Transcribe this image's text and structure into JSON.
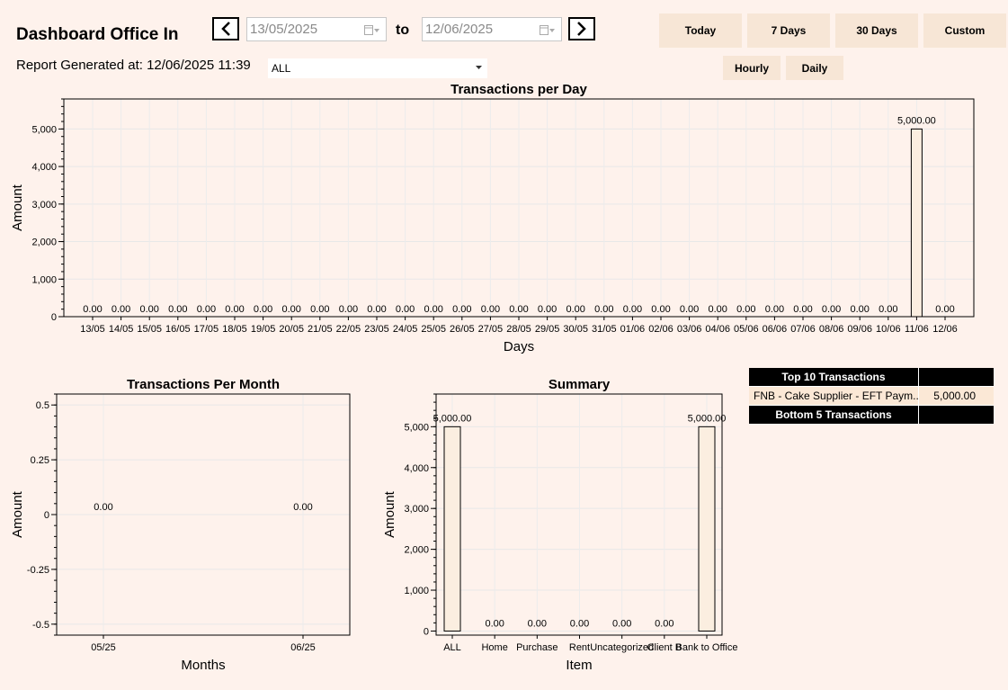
{
  "header": {
    "title": "Dashboard Office In",
    "date_from": "13/05/2025",
    "date_to": "12/06/2025",
    "to_label": "to",
    "report_generated": "Report Generated at: 12/06/2025 11:39",
    "filter_value": "ALL",
    "prev_icon": "chevron-left-icon",
    "next_icon": "chevron-right-icon"
  },
  "range_buttons": [
    "Today",
    "7 Days",
    "30 Days",
    "Custom"
  ],
  "granularity_buttons": [
    "Hourly",
    "Daily"
  ],
  "colors": {
    "background": "#fef2ec",
    "bar_fill": "#fbeee0",
    "button": "#f7e6d6",
    "table_header": "#000000"
  },
  "chart_data": [
    {
      "type": "bar",
      "title": "Transactions per Day",
      "xlabel": "Days",
      "ylabel": "Amount",
      "ylim": [
        0,
        5800
      ],
      "yticks": [
        "0",
        "1,000",
        "2,000",
        "3,000",
        "4,000",
        "5,000"
      ],
      "grid": true,
      "categories": [
        "13/05",
        "14/05",
        "15/05",
        "16/05",
        "17/05",
        "18/05",
        "19/05",
        "20/05",
        "21/05",
        "22/05",
        "23/05",
        "24/05",
        "25/05",
        "26/05",
        "27/05",
        "28/05",
        "29/05",
        "30/05",
        "31/05",
        "01/06",
        "02/06",
        "03/06",
        "04/06",
        "05/06",
        "06/06",
        "07/06",
        "08/06",
        "09/06",
        "10/06",
        "11/06",
        "12/06"
      ],
      "values": [
        0,
        0,
        0,
        0,
        0,
        0,
        0,
        0,
        0,
        0,
        0,
        0,
        0,
        0,
        0,
        0,
        0,
        0,
        0,
        0,
        0,
        0,
        0,
        0,
        0,
        0,
        0,
        0,
        0,
        5000,
        0
      ],
      "data_labels": [
        "0.00",
        "0.00",
        "0.00",
        "0.00",
        "0.00",
        "0.00",
        "0.00",
        "0.00",
        "0.00",
        "0.00",
        "0.00",
        "0.00",
        "0.00",
        "0.00",
        "0.00",
        "0.00",
        "0.00",
        "0.00",
        "0.00",
        "0.00",
        "0.00",
        "0.00",
        "0.00",
        "0.00",
        "0.00",
        "0.00",
        "0.00",
        "0.00",
        "0.00",
        "5,000.00",
        "0.00"
      ]
    },
    {
      "type": "bar",
      "title": "Transactions Per Month",
      "xlabel": "Months",
      "ylabel": "Amount",
      "ylim": [
        -0.55,
        0.55
      ],
      "yticks": [
        "-0.5",
        "-0.25",
        "0",
        "0.25",
        "0.5"
      ],
      "grid": true,
      "categories": [
        "05/25",
        "06/25"
      ],
      "values": [
        0,
        0
      ],
      "data_labels": [
        "0.00",
        "0.00"
      ]
    },
    {
      "type": "bar",
      "title": "Summary",
      "xlabel": "Item",
      "ylabel": "Amount",
      "ylim": [
        -100,
        5800
      ],
      "yticks": [
        "0",
        "1,000",
        "2,000",
        "3,000",
        "4,000",
        "5,000"
      ],
      "grid": true,
      "categories": [
        "ALL",
        "Home",
        "Purchase",
        "Rent",
        "Uncategorized",
        "Client B",
        "Bank to Office"
      ],
      "values": [
        5000,
        0,
        0,
        0,
        0,
        0,
        5000
      ],
      "data_labels": [
        "5,000.00",
        "0.00",
        "0.00",
        "0.00",
        "0.00",
        "0.00",
        "5,000.00"
      ]
    }
  ],
  "table": {
    "top_header": "Top 10 Transactions",
    "top_rows": [
      {
        "description": "FNB - Cake Supplier - EFT Paym...",
        "amount": "5,000.00"
      }
    ],
    "bottom_header": "Bottom 5 Transactions"
  }
}
